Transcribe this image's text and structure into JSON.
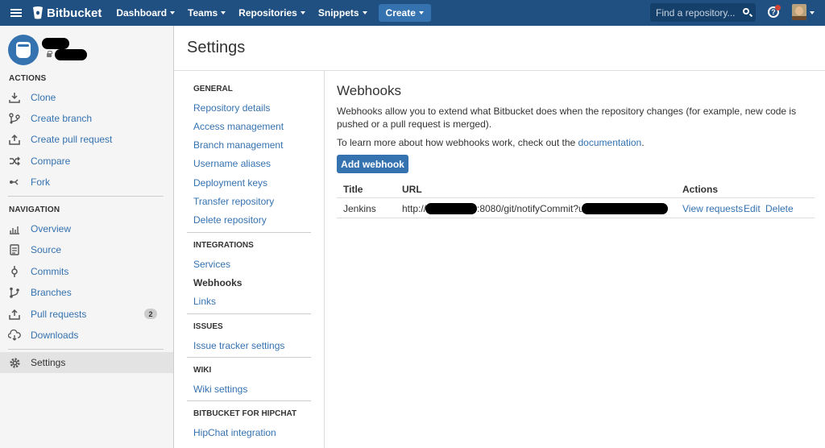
{
  "topbar": {
    "brand": "Bitbucket",
    "nav": [
      {
        "label": "Dashboard"
      },
      {
        "label": "Teams"
      },
      {
        "label": "Repositories"
      },
      {
        "label": "Snippets"
      }
    ],
    "create_label": "Create",
    "search_placeholder": "Find a repository...",
    "help_glyph": "?"
  },
  "sidebar": {
    "actions_heading": "ACTIONS",
    "actions": [
      {
        "label": "Clone",
        "icon": "download-icon"
      },
      {
        "label": "Create branch",
        "icon": "branch-icon"
      },
      {
        "label": "Create pull request",
        "icon": "pull-request-icon"
      },
      {
        "label": "Compare",
        "icon": "compare-icon"
      },
      {
        "label": "Fork",
        "icon": "fork-icon"
      }
    ],
    "navigation_heading": "NAVIGATION",
    "navigation": [
      {
        "label": "Overview",
        "icon": "overview-icon"
      },
      {
        "label": "Source",
        "icon": "source-icon"
      },
      {
        "label": "Commits",
        "icon": "commit-icon"
      },
      {
        "label": "Branches",
        "icon": "branch-icon"
      },
      {
        "label": "Pull requests",
        "icon": "pull-request-icon",
        "badge": "2"
      },
      {
        "label": "Downloads",
        "icon": "cloud-download-icon"
      }
    ],
    "settings_label": "Settings"
  },
  "page": {
    "title": "Settings"
  },
  "settings_nav": {
    "general_heading": "GENERAL",
    "general": [
      "Repository details",
      "Access management",
      "Branch management",
      "Username aliases",
      "Deployment keys",
      "Transfer repository",
      "Delete repository"
    ],
    "integrations_heading": "INTEGRATIONS",
    "integrations": [
      "Services",
      "Webhooks",
      "Links"
    ],
    "issues_heading": "ISSUES",
    "issues": [
      "Issue tracker settings"
    ],
    "wiki_heading": "WIKI",
    "wiki": [
      "Wiki settings"
    ],
    "hipchat_heading": "BITBUCKET FOR HIPCHAT",
    "hipchat": [
      "HipChat integration"
    ]
  },
  "webhooks": {
    "title": "Webhooks",
    "description": "Webhooks allow you to extend what Bitbucket does when the repository changes (for example, new code is pushed or a pull request is merged).",
    "learn_prefix": "To learn more about how webhooks work, check out the ",
    "learn_link": "documentation",
    "learn_suffix": ".",
    "add_button": "Add webhook",
    "columns": {
      "title": "Title",
      "url": "URL",
      "actions": "Actions"
    },
    "rows": [
      {
        "title": "Jenkins",
        "url_prefix": "http://",
        "url_middle": ":8080/git/notifyCommit?url=",
        "actions": [
          "View requests",
          "Edit",
          "Delete"
        ]
      }
    ]
  }
}
